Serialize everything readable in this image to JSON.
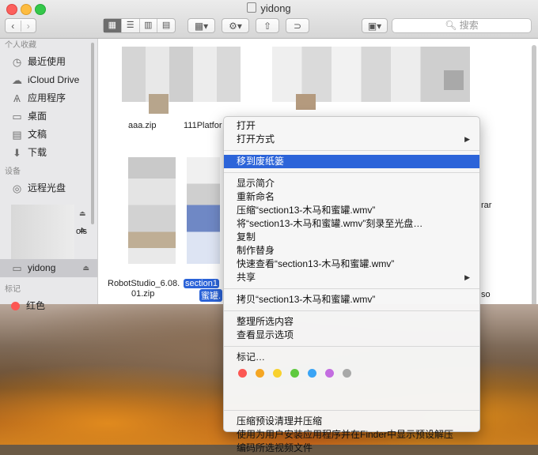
{
  "window": {
    "title": "yidong"
  },
  "toolbar": {
    "back_icon": "chevron-left-icon",
    "forward_icon": "chevron-right-icon",
    "view_modes": [
      "icon-view-icon",
      "list-view-icon",
      "column-view-icon",
      "coverflow-view-icon"
    ],
    "search_placeholder": "搜索"
  },
  "sidebar": {
    "favorites_header": "个人收藏",
    "favorites": [
      {
        "label": "最近使用",
        "icon": "clock-icon"
      },
      {
        "label": "iCloud Drive",
        "icon": "cloud-icon"
      },
      {
        "label": "应用程序",
        "icon": "apps-icon"
      },
      {
        "label": "桌面",
        "icon": "desktop-icon"
      },
      {
        "label": "文稿",
        "icon": "document-icon"
      },
      {
        "label": "下载",
        "icon": "download-icon"
      }
    ],
    "devices_header": "设备",
    "devices": [
      {
        "label": "远程光盘",
        "icon": "disc-icon"
      },
      {
        "label": "yidong",
        "icon": "drive-icon"
      }
    ],
    "tags_header": "标记",
    "tags": [
      {
        "label": "红色",
        "color": "#fc5753"
      }
    ]
  },
  "files": {
    "visible_names": [
      "aaa.zip",
      "111Platfor",
      "RobotStudio_6.08.",
      "01.zip",
      "section1",
      "蜜罐.",
      "rar",
      "ols",
      "so"
    ]
  },
  "context_menu": {
    "items_group1": [
      "打开",
      "打开方式"
    ],
    "highlighted": "移到废纸篓",
    "items_group2": [
      "显示简介",
      "重新命名",
      "压缩“section13-木马和蜜罐.wmv”",
      "将“section13-木马和蜜罐.wmv”刻录至光盘…",
      "复制",
      "制作替身",
      "快速查看“section13-木马和蜜罐.wmv”",
      "共享"
    ],
    "items_group3": [
      "拷贝“section13-木马和蜜罐.wmv”"
    ],
    "items_group4": [
      "整理所选内容",
      "查看显示选项"
    ],
    "tags_label": "标记…",
    "tag_colors": [
      "#fc5753",
      "#f5a623",
      "#f8d12f",
      "#5fc93f",
      "#3aa4f5",
      "#c36de0",
      "#a8a8a8"
    ],
    "items_group5": [
      "压缩预设清理并压缩",
      "使用为用户安装应用程序并在Finder中显示预设解压",
      "编码所选视频文件"
    ]
  }
}
